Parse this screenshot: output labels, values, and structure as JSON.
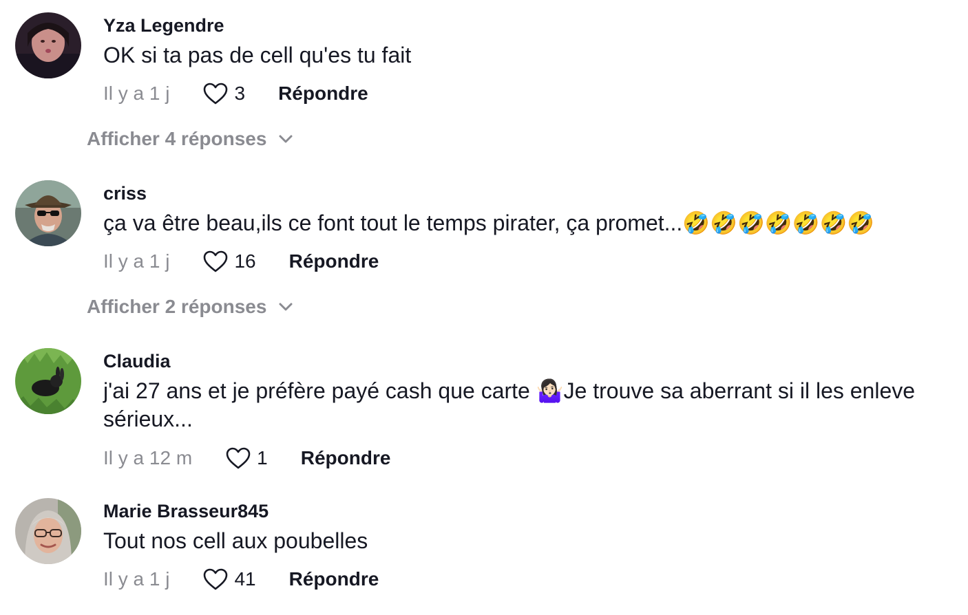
{
  "comments": [
    {
      "username": "Yza Legendre",
      "text": "OK si ta pas de cell qu'es tu fait",
      "time": "Il y a 1 j",
      "likes": "3",
      "reply_label": "Répondre",
      "show_replies": "Afficher 4 réponses"
    },
    {
      "username": "criss",
      "text": "ça va être beau,ils ce font tout le temps pirater, ça promet...🤣🤣🤣🤣🤣🤣🤣",
      "time": "Il y a 1 j",
      "likes": "16",
      "reply_label": "Répondre",
      "show_replies": "Afficher 2 réponses"
    },
    {
      "username": "Claudia",
      "text": "j'ai 27 ans et je préfère payé cash que carte 🤷🏻‍♀️Je trouve sa aberrant si il les enleve sérieux...",
      "time": "Il y a 12 m",
      "likes": "1",
      "reply_label": "Répondre"
    },
    {
      "username": "Marie Brasseur845",
      "text": "Tout nos cell aux poubelles",
      "time": "Il y a 1 j",
      "likes": "41",
      "reply_label": "Répondre"
    }
  ],
  "colors": {
    "primary_text": "#161823",
    "secondary_text": "#8a8b91"
  },
  "icons": {
    "like": "heart-outline-icon",
    "expand": "chevron-down-icon"
  }
}
